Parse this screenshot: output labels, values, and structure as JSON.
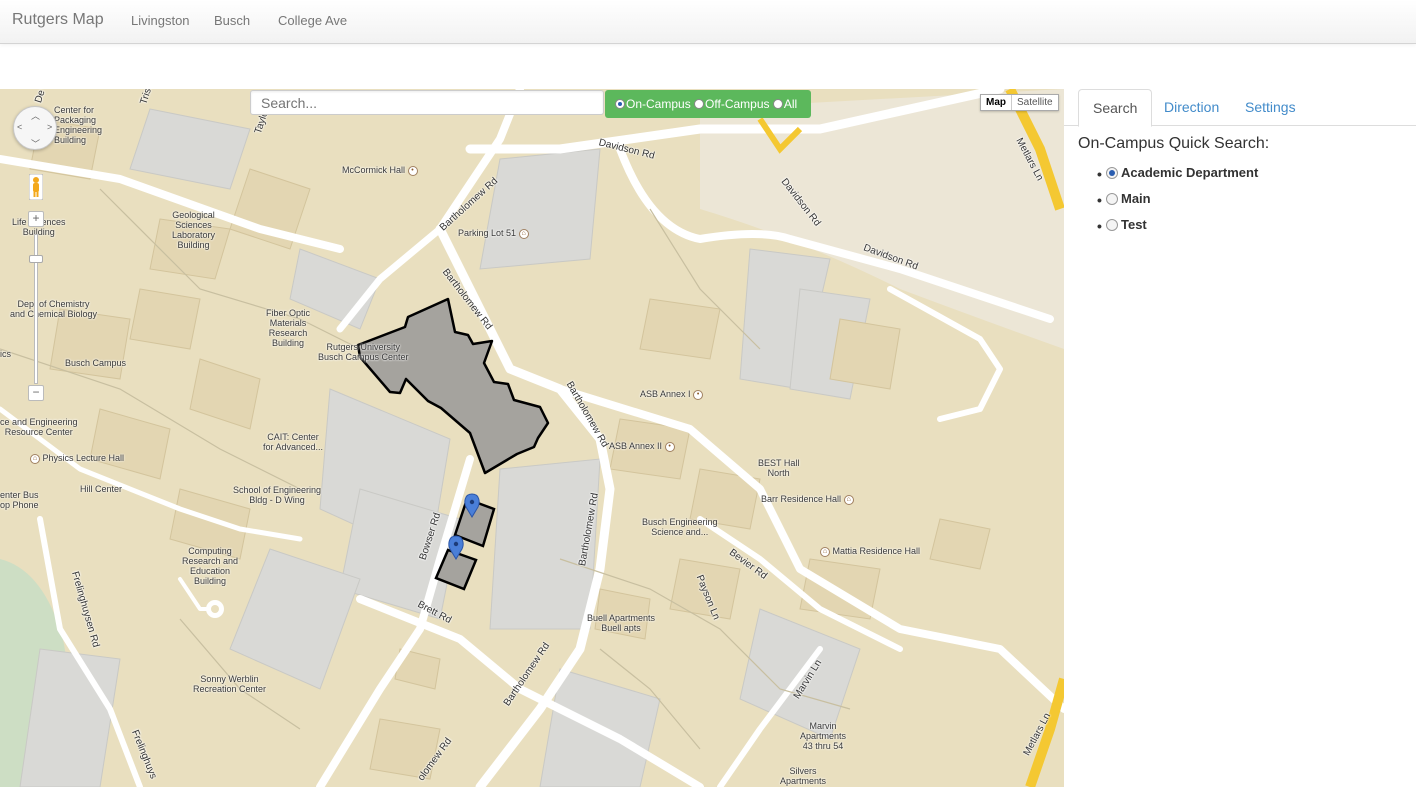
{
  "navbar": {
    "brand": "Rutgers Map",
    "links": [
      "Livingston",
      "Busch",
      "College Ave"
    ]
  },
  "map": {
    "search_placeholder": "Search...",
    "filter": {
      "options": [
        "On-Campus",
        "Off-Campus",
        "All"
      ],
      "selected": "On-Campus"
    },
    "map_types": [
      "Map",
      "Satellite"
    ],
    "selected_map_type": "Map",
    "zoom_controls": {
      "plus": "+",
      "minus": "−"
    },
    "labels": {
      "center_packaging": [
        "Center for",
        "Packaging",
        "Engineering",
        "Building"
      ],
      "mccormick": "McCormick Hall",
      "geological": [
        "Geological",
        "Sciences",
        "Laboratory",
        "Building"
      ],
      "life_sciences": [
        "Life Sciences",
        "Building"
      ],
      "parking51": "Parking Lot 51",
      "chemistry": [
        "Dept of Chemistry",
        "and Chemical Biology"
      ],
      "fiber_optic": [
        "Fiber Optic",
        "Materials",
        "Research",
        "Building"
      ],
      "student_center": [
        "Rutgers University",
        "Busch Campus Center"
      ],
      "busch_campus": "Busch Campus",
      "asb1": "ASB Annex I",
      "asb2": "ASB Annex II",
      "engineering_resource": [
        "ce and Engineering",
        "Resource Center"
      ],
      "cait": [
        "CAIT: Center",
        "for Advanced..."
      ],
      "physics": "Physics Lecture Hall",
      "best": [
        "BEST Hall",
        "North"
      ],
      "barr": "Barr Residence Hall",
      "hill": "Hill Center",
      "eng_d": [
        "School of Engineering",
        "Bldg - D Wing"
      ],
      "enter_bus": [
        "enter Bus",
        "op Phone"
      ],
      "busch_eng": [
        "Busch Engineering",
        "Science and..."
      ],
      "mattia": "Mattia Residence Hall",
      "computing": [
        "Computing",
        "Research and",
        "Education",
        "Building"
      ],
      "buell": [
        "Buell Apartments",
        "Buell apts"
      ],
      "werblin": [
        "Sonny Werblin",
        "Recreation Center"
      ],
      "marvin": [
        "Marvin",
        "Apartments",
        "43 thru 54"
      ],
      "silvers": [
        "Silvers",
        "Apartments"
      ],
      "ics": "ics"
    },
    "roads": {
      "davidson1": "Davidson Rd",
      "davidson2": "Davidson Rd",
      "davidson3": "Davidson Rd",
      "bartholomew1": "Bartholomew Rd",
      "bartholomew2": "Bartholomew Rd",
      "bartholomew3": "Bartholomew Rd",
      "bartholomew4": "Bartholomew Rd",
      "bartholomew5": "Bartholomew Rd",
      "bartholomew6": "olomew Rd",
      "bowser": "Bowser Rd",
      "brett": "Brett Rd",
      "bevier": "Bevier Rd",
      "payson": "Payson Ln",
      "marvin": "Marvin Ln",
      "metlars1": "Metlars Ln",
      "metlars2": "Metlars Ln",
      "frelinghuysen1": "Frelinghuysen Rd",
      "frelinghuysen2": "Frelinghuys",
      "taylor": "Taylo",
      "de": "De",
      "tris": "Tris"
    }
  },
  "panel": {
    "tabs": [
      "Search",
      "Direction",
      "Settings"
    ],
    "active_tab": "Search",
    "quick_search_title": "On-Campus Quick Search:",
    "options": [
      "Academic Department",
      "Main",
      "Test"
    ],
    "selected_option": "Academic Department"
  }
}
